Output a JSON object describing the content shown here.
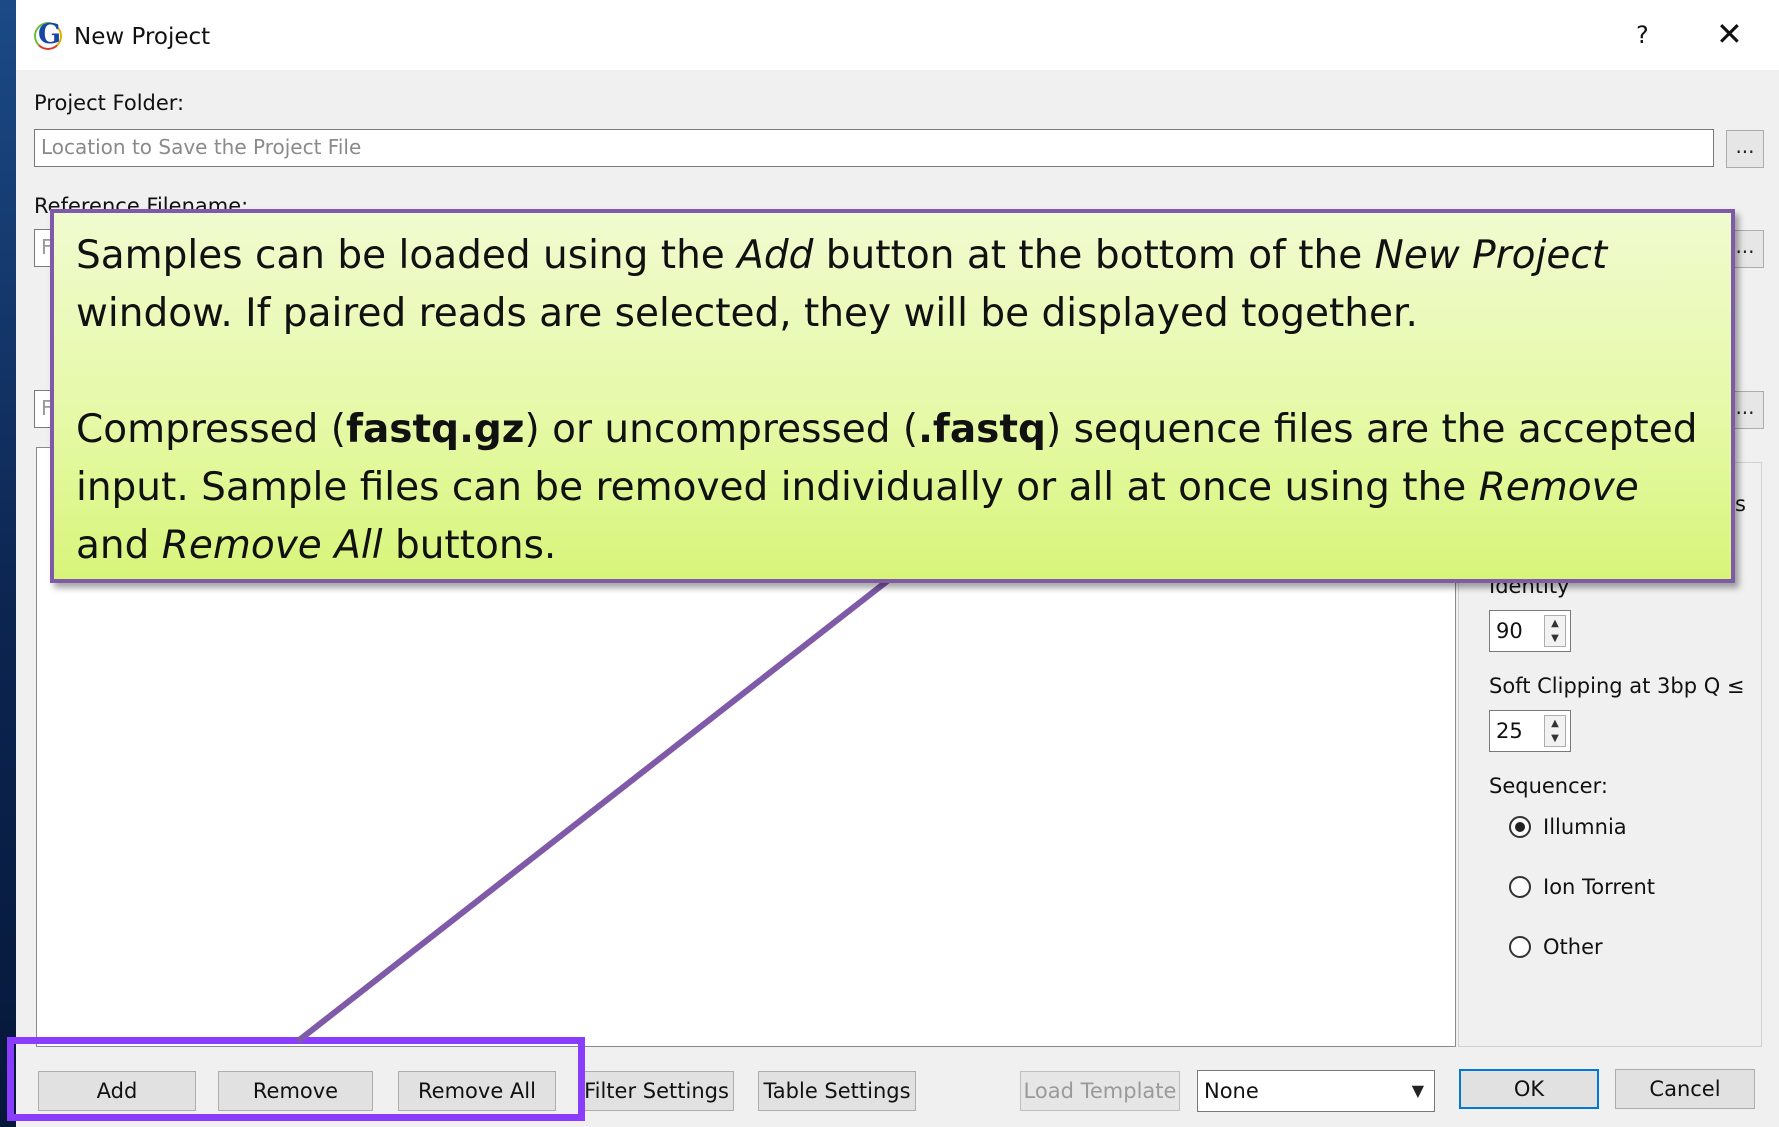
{
  "window": {
    "title": "New Project",
    "help_label": "?",
    "close_label": "✕",
    "app_icon_letter": "G"
  },
  "project_folder": {
    "label": "Project Folder:",
    "placeholder": "Location to Save the Project File",
    "browse_label": "..."
  },
  "reference": {
    "label": "Reference Filename:",
    "field_text": "F",
    "browse_label": "..."
  },
  "third_row": {
    "field_text": "F",
    "browse_label": "..."
  },
  "options": {
    "identity_label": "Identity",
    "identity_value": "90",
    "soft_clip_label": "Soft Clipping at 3bp Q ≤",
    "soft_clip_value": "25",
    "sequencer_label": "Sequencer:",
    "sequencers": [
      {
        "label": "Illumnia",
        "checked": true
      },
      {
        "label": "Ion Torrent",
        "checked": false
      },
      {
        "label": "Other",
        "checked": false
      }
    ],
    "cut_label": "s"
  },
  "buttons": {
    "add": "Add",
    "remove": "Remove",
    "remove_all": "Remove All",
    "filter_settings": "Filter Settings",
    "table_settings": "Table Settings",
    "load_template": "Load Template",
    "template_select": "None",
    "ok": "OK",
    "cancel": "Cancel"
  },
  "callout": {
    "p1": {
      "t1": "Samples can be loaded using the ",
      "em1": "Add",
      "t2": " button at the bottom of the ",
      "em2": "New Project",
      "t3": " window. If paired reads are selected, they will be displayed together."
    },
    "p2": {
      "t1": "Compressed (",
      "b1": "fastq.gz",
      "t2": ") or uncompressed (",
      "b2": ".fastq",
      "t3": ") sequence files are the accepted input. Sample files can be removed individually or all at once using the ",
      "em1": "Remove",
      "t4": " and ",
      "em2": "Remove All",
      "t5": " buttons."
    }
  },
  "colors": {
    "highlight_border": "#8a3cff",
    "connector_line": "#7f5aa8",
    "callout_border": "#7f5aa8",
    "ok_focus": "#0078d7"
  }
}
